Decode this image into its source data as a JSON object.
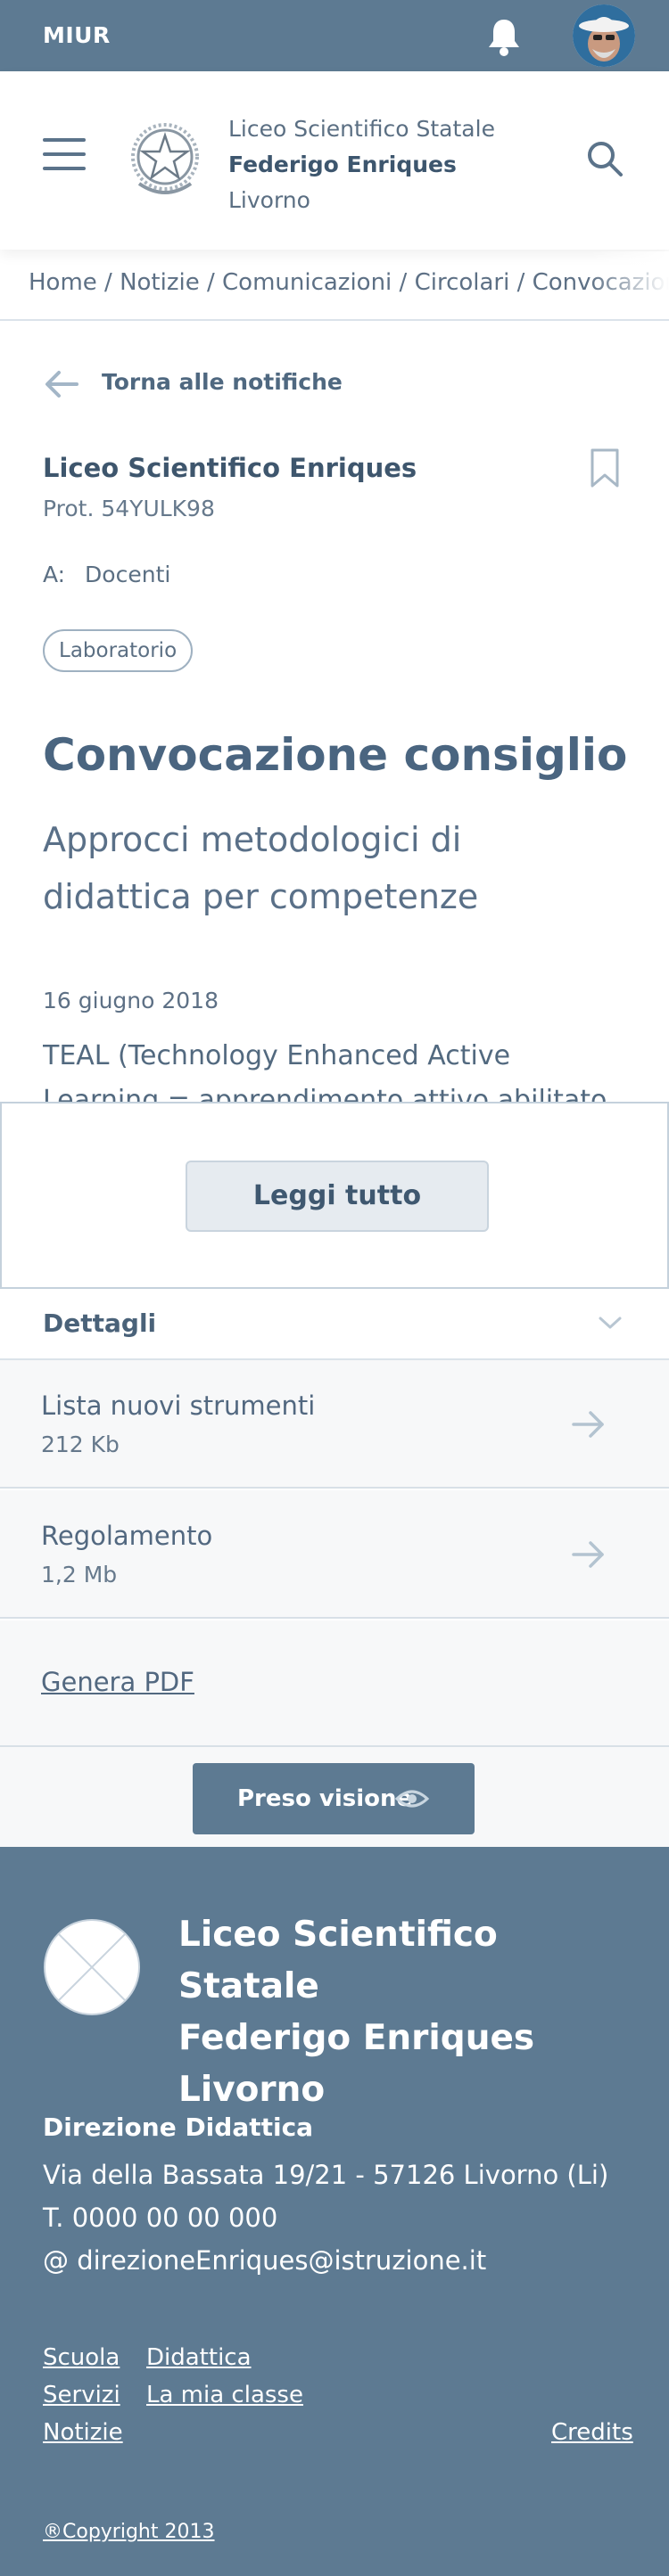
{
  "topbar": {
    "brand": "MIUR"
  },
  "header": {
    "school_line1": "Liceo Scientifico Statale",
    "school_line2": "Federigo Enriques",
    "school_line3": "Livorno"
  },
  "breadcrumb": "Home / Notizie / Comunicazioni / Circolari / Convocazione",
  "back_label": "Torna alle notifiche",
  "notice": {
    "sender": "Liceo Scientifico Enriques",
    "prot": "Prot. 54YULK98",
    "recipient_label": "A:",
    "recipient": "Docenti",
    "tag": "Laboratorio",
    "title": "Convocazione consiglio",
    "subtitle": "Approcci metodologici di didattica per competenze",
    "date": "16 giugno 2018",
    "excerpt": "TEAL (Technology Enhanced Active Learning = apprendimento attivo abilitato attraverso"
  },
  "read_more": "Leggi tutto",
  "details_label": "Dettagli",
  "attachments": [
    {
      "name": "Lista nuovi strumenti",
      "size": "212 Kb"
    },
    {
      "name": "Regolamento",
      "size": "1,2 Mb"
    }
  ],
  "generate_pdf": "Genera PDF",
  "preso_visione": "Preso visione",
  "footer": {
    "name_line1": "Liceo Scientifico Statale",
    "name_line2": "Federigo Enriques",
    "name_line3": "Livorno",
    "direzione": "Direzione Didattica",
    "address": "Via della Bassata 19/21 - 57126 Livorno (Li)",
    "phone": "T. 0000 00 00 000",
    "email": "@ direzioneEnriques@istruzione.it",
    "links": [
      "Scuola",
      "Didattica",
      "Servizi",
      "La mia classe",
      "Notizie",
      "Credits"
    ],
    "copyright": "®Copyright 2013"
  },
  "colors": {
    "primary": "#5d7a92",
    "text": "#455b71",
    "light_bg": "#f7f8f9"
  }
}
